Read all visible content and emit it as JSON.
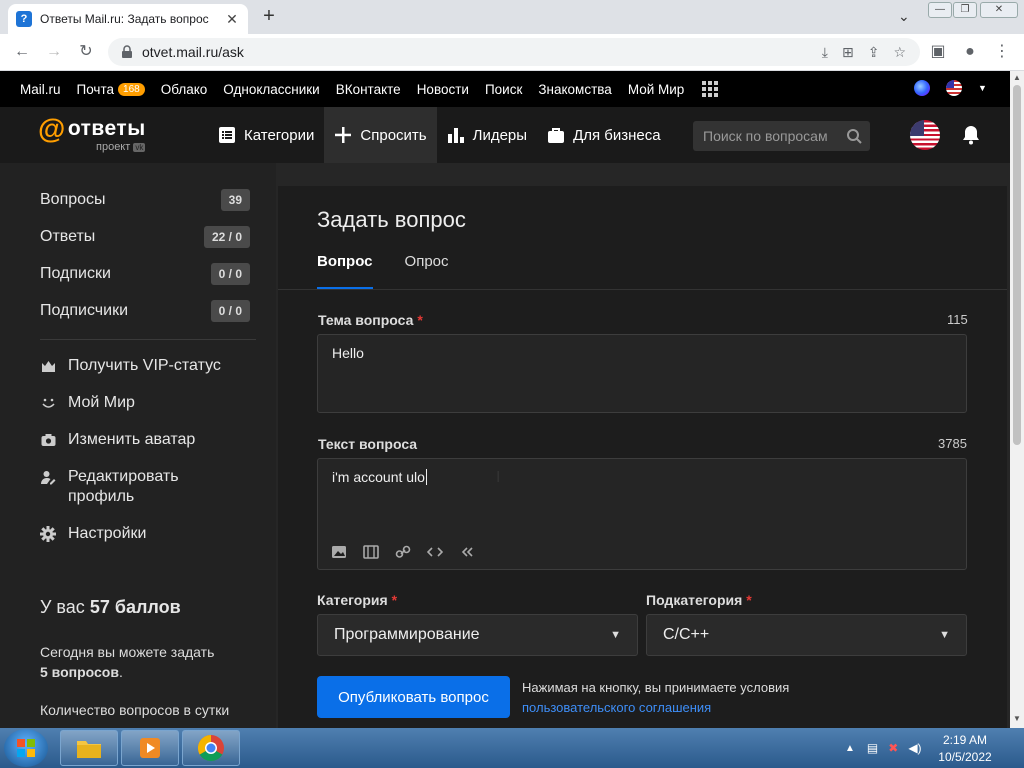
{
  "browser": {
    "tab_title": "Ответы Mail.ru: Задать вопрос",
    "url": "otvet.mail.ru/ask"
  },
  "mailru_bar": {
    "links": [
      "Mail.ru",
      "Почта",
      "Облако",
      "Одноклассники",
      "ВКонтакте",
      "Новости",
      "Поиск",
      "Знакомства",
      "Мой Мир"
    ],
    "mail_badge": "168"
  },
  "header": {
    "logo": "ответы",
    "logo_sub": "проект",
    "nav": [
      "Категории",
      "Спросить",
      "Лидеры",
      "Для бизнеса"
    ],
    "search_placeholder": "Поиск по вопросам"
  },
  "sidebar": {
    "stats": [
      {
        "label": "Вопросы",
        "count": "39"
      },
      {
        "label": "Ответы",
        "count": "22 / 0"
      },
      {
        "label": "Подписки",
        "count": "0 / 0"
      },
      {
        "label": "Подписчики",
        "count": "0 / 0"
      }
    ],
    "links": [
      "Получить VIP-статус",
      "Мой Мир",
      "Изменить аватар",
      "Редактировать профиль",
      "Настройки"
    ],
    "points_prefix": "У вас",
    "points_value": "57 баллов",
    "today_text": "Сегодня вы можете задать",
    "today_count": "5 вопросов",
    "limit_text": "Количество вопросов в сутки"
  },
  "form": {
    "title": "Задать вопрос",
    "tabs": [
      "Вопрос",
      "Опрос"
    ],
    "topic_label": "Тема вопроса",
    "topic_count": "115",
    "topic_value": "Hello",
    "text_label": "Текст вопроса",
    "text_count": "3785",
    "text_value": "i'm account ulo",
    "category_label": "Категория",
    "category_value": "Программирование",
    "subcategory_label": "Подкатегория",
    "subcategory_value": "C/C++",
    "publish_label": "Опубликовать вопрос",
    "terms_text": "Нажимая на кнопку, вы принимаете условия",
    "terms_link": "пользовательского соглашения"
  },
  "taskbar": {
    "time": "2:19 AM",
    "date": "10/5/2022"
  },
  "colors": {
    "accent": "#0a6fe8",
    "brand_orange": "#ff9e00",
    "required": "#e53935"
  }
}
